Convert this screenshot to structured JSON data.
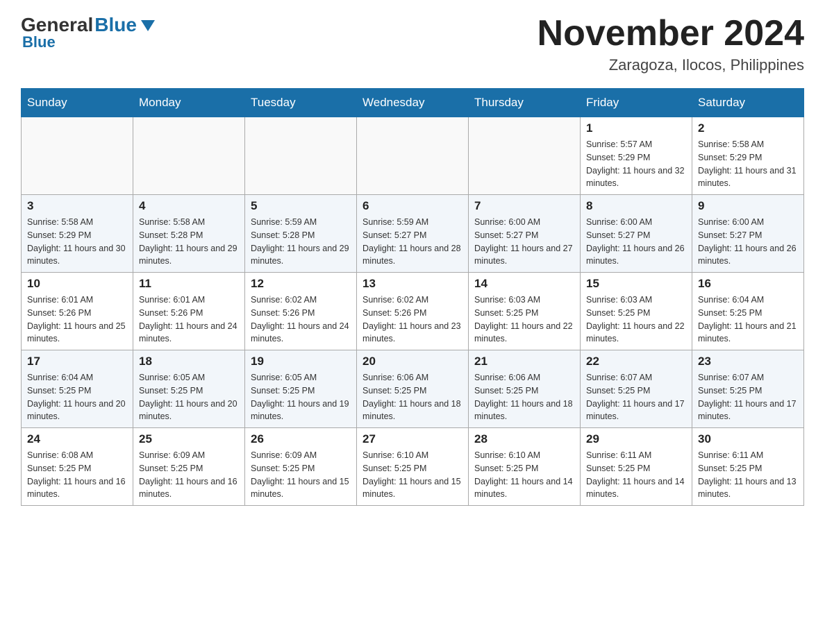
{
  "header": {
    "logo_general": "General",
    "logo_blue": "Blue",
    "month_title": "November 2024",
    "location": "Zaragoza, Ilocos, Philippines"
  },
  "weekdays": [
    "Sunday",
    "Monday",
    "Tuesday",
    "Wednesday",
    "Thursday",
    "Friday",
    "Saturday"
  ],
  "rows": [
    [
      {
        "day": "",
        "sunrise": "",
        "sunset": "",
        "daylight": ""
      },
      {
        "day": "",
        "sunrise": "",
        "sunset": "",
        "daylight": ""
      },
      {
        "day": "",
        "sunrise": "",
        "sunset": "",
        "daylight": ""
      },
      {
        "day": "",
        "sunrise": "",
        "sunset": "",
        "daylight": ""
      },
      {
        "day": "",
        "sunrise": "",
        "sunset": "",
        "daylight": ""
      },
      {
        "day": "1",
        "sunrise": "Sunrise: 5:57 AM",
        "sunset": "Sunset: 5:29 PM",
        "daylight": "Daylight: 11 hours and 32 minutes."
      },
      {
        "day": "2",
        "sunrise": "Sunrise: 5:58 AM",
        "sunset": "Sunset: 5:29 PM",
        "daylight": "Daylight: 11 hours and 31 minutes."
      }
    ],
    [
      {
        "day": "3",
        "sunrise": "Sunrise: 5:58 AM",
        "sunset": "Sunset: 5:29 PM",
        "daylight": "Daylight: 11 hours and 30 minutes."
      },
      {
        "day": "4",
        "sunrise": "Sunrise: 5:58 AM",
        "sunset": "Sunset: 5:28 PM",
        "daylight": "Daylight: 11 hours and 29 minutes."
      },
      {
        "day": "5",
        "sunrise": "Sunrise: 5:59 AM",
        "sunset": "Sunset: 5:28 PM",
        "daylight": "Daylight: 11 hours and 29 minutes."
      },
      {
        "day": "6",
        "sunrise": "Sunrise: 5:59 AM",
        "sunset": "Sunset: 5:27 PM",
        "daylight": "Daylight: 11 hours and 28 minutes."
      },
      {
        "day": "7",
        "sunrise": "Sunrise: 6:00 AM",
        "sunset": "Sunset: 5:27 PM",
        "daylight": "Daylight: 11 hours and 27 minutes."
      },
      {
        "day": "8",
        "sunrise": "Sunrise: 6:00 AM",
        "sunset": "Sunset: 5:27 PM",
        "daylight": "Daylight: 11 hours and 26 minutes."
      },
      {
        "day": "9",
        "sunrise": "Sunrise: 6:00 AM",
        "sunset": "Sunset: 5:27 PM",
        "daylight": "Daylight: 11 hours and 26 minutes."
      }
    ],
    [
      {
        "day": "10",
        "sunrise": "Sunrise: 6:01 AM",
        "sunset": "Sunset: 5:26 PM",
        "daylight": "Daylight: 11 hours and 25 minutes."
      },
      {
        "day": "11",
        "sunrise": "Sunrise: 6:01 AM",
        "sunset": "Sunset: 5:26 PM",
        "daylight": "Daylight: 11 hours and 24 minutes."
      },
      {
        "day": "12",
        "sunrise": "Sunrise: 6:02 AM",
        "sunset": "Sunset: 5:26 PM",
        "daylight": "Daylight: 11 hours and 24 minutes."
      },
      {
        "day": "13",
        "sunrise": "Sunrise: 6:02 AM",
        "sunset": "Sunset: 5:26 PM",
        "daylight": "Daylight: 11 hours and 23 minutes."
      },
      {
        "day": "14",
        "sunrise": "Sunrise: 6:03 AM",
        "sunset": "Sunset: 5:25 PM",
        "daylight": "Daylight: 11 hours and 22 minutes."
      },
      {
        "day": "15",
        "sunrise": "Sunrise: 6:03 AM",
        "sunset": "Sunset: 5:25 PM",
        "daylight": "Daylight: 11 hours and 22 minutes."
      },
      {
        "day": "16",
        "sunrise": "Sunrise: 6:04 AM",
        "sunset": "Sunset: 5:25 PM",
        "daylight": "Daylight: 11 hours and 21 minutes."
      }
    ],
    [
      {
        "day": "17",
        "sunrise": "Sunrise: 6:04 AM",
        "sunset": "Sunset: 5:25 PM",
        "daylight": "Daylight: 11 hours and 20 minutes."
      },
      {
        "day": "18",
        "sunrise": "Sunrise: 6:05 AM",
        "sunset": "Sunset: 5:25 PM",
        "daylight": "Daylight: 11 hours and 20 minutes."
      },
      {
        "day": "19",
        "sunrise": "Sunrise: 6:05 AM",
        "sunset": "Sunset: 5:25 PM",
        "daylight": "Daylight: 11 hours and 19 minutes."
      },
      {
        "day": "20",
        "sunrise": "Sunrise: 6:06 AM",
        "sunset": "Sunset: 5:25 PM",
        "daylight": "Daylight: 11 hours and 18 minutes."
      },
      {
        "day": "21",
        "sunrise": "Sunrise: 6:06 AM",
        "sunset": "Sunset: 5:25 PM",
        "daylight": "Daylight: 11 hours and 18 minutes."
      },
      {
        "day": "22",
        "sunrise": "Sunrise: 6:07 AM",
        "sunset": "Sunset: 5:25 PM",
        "daylight": "Daylight: 11 hours and 17 minutes."
      },
      {
        "day": "23",
        "sunrise": "Sunrise: 6:07 AM",
        "sunset": "Sunset: 5:25 PM",
        "daylight": "Daylight: 11 hours and 17 minutes."
      }
    ],
    [
      {
        "day": "24",
        "sunrise": "Sunrise: 6:08 AM",
        "sunset": "Sunset: 5:25 PM",
        "daylight": "Daylight: 11 hours and 16 minutes."
      },
      {
        "day": "25",
        "sunrise": "Sunrise: 6:09 AM",
        "sunset": "Sunset: 5:25 PM",
        "daylight": "Daylight: 11 hours and 16 minutes."
      },
      {
        "day": "26",
        "sunrise": "Sunrise: 6:09 AM",
        "sunset": "Sunset: 5:25 PM",
        "daylight": "Daylight: 11 hours and 15 minutes."
      },
      {
        "day": "27",
        "sunrise": "Sunrise: 6:10 AM",
        "sunset": "Sunset: 5:25 PM",
        "daylight": "Daylight: 11 hours and 15 minutes."
      },
      {
        "day": "28",
        "sunrise": "Sunrise: 6:10 AM",
        "sunset": "Sunset: 5:25 PM",
        "daylight": "Daylight: 11 hours and 14 minutes."
      },
      {
        "day": "29",
        "sunrise": "Sunrise: 6:11 AM",
        "sunset": "Sunset: 5:25 PM",
        "daylight": "Daylight: 11 hours and 14 minutes."
      },
      {
        "day": "30",
        "sunrise": "Sunrise: 6:11 AM",
        "sunset": "Sunset: 5:25 PM",
        "daylight": "Daylight: 11 hours and 13 minutes."
      }
    ]
  ]
}
